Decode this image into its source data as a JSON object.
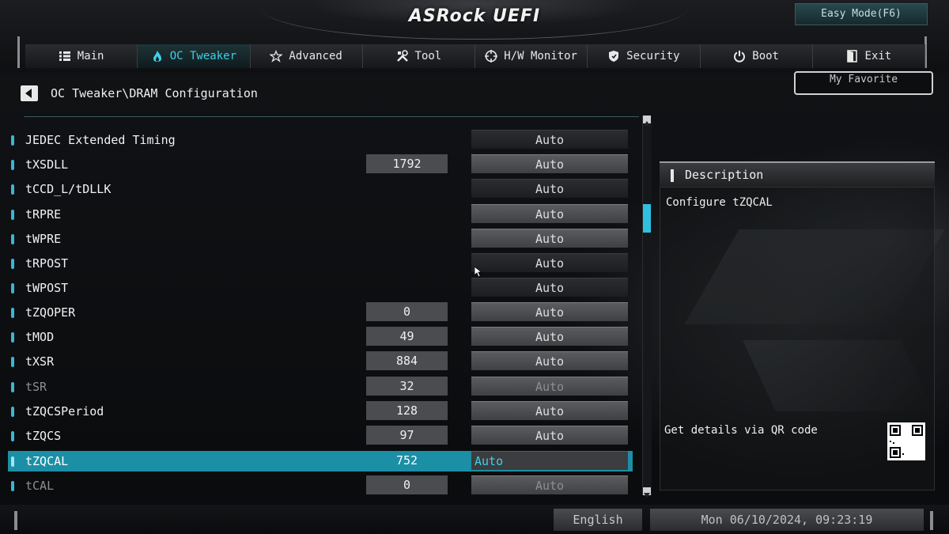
{
  "header": {
    "logo": "ASRock UEFI",
    "easy_mode_label": "Easy Mode(F6)"
  },
  "tabs": [
    {
      "label": "Main",
      "icon": "list-icon"
    },
    {
      "label": "OC Tweaker",
      "icon": "flame-icon",
      "active": true
    },
    {
      "label": "Advanced",
      "icon": "star-icon"
    },
    {
      "label": "Tool",
      "icon": "tools-icon"
    },
    {
      "label": "H/W Monitor",
      "icon": "crosshair-icon"
    },
    {
      "label": "Security",
      "icon": "shield-icon"
    },
    {
      "label": "Boot",
      "icon": "power-icon"
    },
    {
      "label": "Exit",
      "icon": "exit-door-icon"
    }
  ],
  "breadcrumb": "OC Tweaker\\DRAM Configuration",
  "favorite_label": "My Favorite",
  "settings": [
    {
      "label": "JEDEC Extended Timing",
      "value": "",
      "option": "Auto",
      "option_style": "dark"
    },
    {
      "label": "tXSDLL",
      "value": "1792",
      "option": "Auto"
    },
    {
      "label": "tCCD_L/tDLLK",
      "value": "",
      "option": "Auto",
      "option_style": "dark"
    },
    {
      "label": "tRPRE",
      "value": "",
      "option": "Auto"
    },
    {
      "label": "tWPRE",
      "value": "",
      "option": "Auto"
    },
    {
      "label": "tRPOST",
      "value": "",
      "option": "Auto",
      "option_style": "dark"
    },
    {
      "label": "tWPOST",
      "value": "",
      "option": "Auto",
      "option_style": "dark"
    },
    {
      "label": "tZQOPER",
      "value": "0",
      "option": "Auto"
    },
    {
      "label": "tMOD",
      "value": "49",
      "option": "Auto"
    },
    {
      "label": "tXSR",
      "value": "884",
      "option": "Auto"
    },
    {
      "label": "tSR",
      "value": "32",
      "option": "Auto",
      "dim": true
    },
    {
      "label": "tZQCSPeriod",
      "value": "128",
      "option": "Auto"
    },
    {
      "label": "tZQCS",
      "value": "97",
      "option": "Auto"
    },
    {
      "label": "tZQCAL",
      "value": "752",
      "option": "Auto",
      "selected": true
    },
    {
      "label": "tCAL",
      "value": "0",
      "option": "Auto",
      "dim": true
    }
  ],
  "description": {
    "title": "Description",
    "text": "Configure tZQCAL",
    "qr_text": "Get details via QR code"
  },
  "footer": {
    "language": "English",
    "datetime": "Mon 06/10/2024, 09:23:19"
  }
}
